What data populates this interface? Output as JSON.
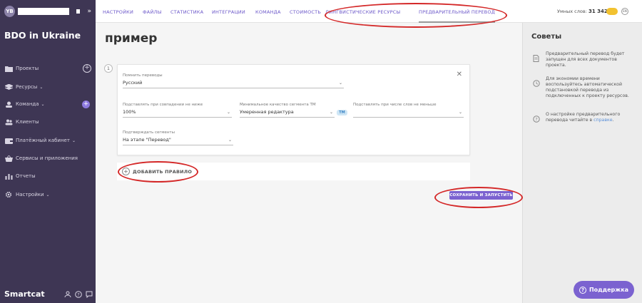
{
  "sidebar": {
    "avatar_initials": "YB",
    "workspace": "BDO in Ukraine",
    "items": [
      {
        "label": "Проекты",
        "icon": "folder-icon"
      },
      {
        "label": "Ресурсы",
        "icon": "layers-icon"
      },
      {
        "label": "Команда",
        "icon": "team-icon"
      },
      {
        "label": "Клиенты",
        "icon": "clients-icon"
      },
      {
        "label": "Платёжный кабинет",
        "icon": "wallet-icon"
      },
      {
        "label": "Сервисы и приложения",
        "icon": "basket-icon"
      },
      {
        "label": "Отчеты",
        "icon": "reports-icon"
      },
      {
        "label": "Настройки",
        "icon": "gear-icon"
      }
    ],
    "brand": "Smartcat"
  },
  "topbar": {
    "tabs": [
      {
        "label": "НАСТРОЙКИ"
      },
      {
        "label": "ФАЙЛЫ"
      },
      {
        "label": "СТАТИСТИКА"
      },
      {
        "label": "ИНТЕГРАЦИИ"
      },
      {
        "label": "КОМАНДА"
      },
      {
        "label": "СТОИМОСТЬ"
      },
      {
        "label": "ЛИНГВИСТИЧЕСКИЕ РЕСУРСЫ"
      },
      {
        "label": "ПРЕДВАРИТЕЛЬНЫЙ ПЕРЕВОД"
      }
    ],
    "words_label": "Умных слов:",
    "words_value": "31 342",
    "lang": "EN"
  },
  "main": {
    "title": "пример",
    "rule_number": "1",
    "fields": {
      "memory_label": "Помнить переводы",
      "memory_value": "Русский",
      "match_label": "Подставлять при совпадении не ниже",
      "match_value": "100%",
      "quality_label": "Минимальное качество сегмента ТМ",
      "quality_value": "Умеренная редактура",
      "quality_badge": "ТМ",
      "words_min_label": "Подставлять при числе слов не меньше",
      "words_min_value": "",
      "confirm_label": "Подтверждать сегменты",
      "confirm_value": "На этапе \"Перевод\""
    },
    "add_rule_label": "ДОБАВИТЬ ПРАВИЛО",
    "save_label": "СОХРАНИТЬ И ЗАПУСТИТЬ"
  },
  "tips": {
    "title": "Советы",
    "items": [
      {
        "text": "Предварительный перевод будет запущен для всех документов проекта."
      },
      {
        "text": "Для экономии времени воспользуйтесь автоматической подстановкой перевода из подключенных к проекту ресурсов."
      },
      {
        "text": "О настройке предварительного перевода читайте в ",
        "link": "справке",
        "suffix": "."
      }
    ]
  },
  "support": {
    "label": "Поддержка"
  },
  "colors": {
    "sidebar_bg": "#3e3654",
    "accent": "#7b62d0",
    "tab_text": "#6b57c9",
    "annotation": "#d42828"
  }
}
